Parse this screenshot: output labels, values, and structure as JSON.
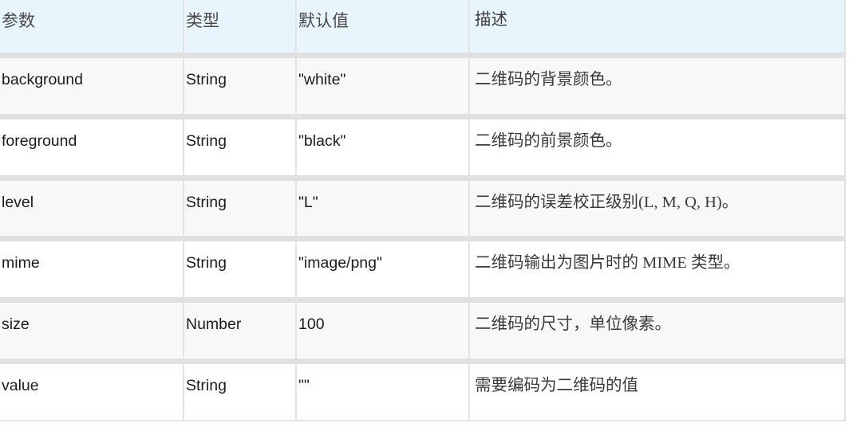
{
  "table": {
    "name": "qr-code-parameters",
    "colors": {
      "header_background": "#e8f5fd",
      "row_odd_background": "#f8f8f8",
      "row_even_background": "#ffffff",
      "border": "#e0e0e0",
      "header_text": "#4a4a4a",
      "body_text": "#1c1c1c",
      "description_text": "#3b3b3b"
    },
    "columns": [
      {
        "key": "param",
        "label": "参数"
      },
      {
        "key": "type",
        "label": "类型"
      },
      {
        "key": "default",
        "label": "默认值"
      },
      {
        "key": "desc",
        "label": "描述"
      }
    ],
    "rows": [
      {
        "param": "background",
        "type": "String",
        "default": "\"white\"",
        "desc": "二维码的背景颜色。"
      },
      {
        "param": "foreground",
        "type": "String",
        "default": "\"black\"",
        "desc": "二维码的前景颜色。"
      },
      {
        "param": "level",
        "type": "String",
        "default": "\"L\"",
        "desc": "二维码的误差校正级别(L, M, Q, H)。"
      },
      {
        "param": "mime",
        "type": "String",
        "default": "\"image/png\"",
        "desc": "二维码输出为图片时的 MIME 类型。"
      },
      {
        "param": "size",
        "type": "Number",
        "default": "100",
        "desc": "二维码的尺寸，单位像素。"
      },
      {
        "param": "value",
        "type": "String",
        "default": "\"\"",
        "desc": "需要编码为二维码的值"
      }
    ]
  }
}
